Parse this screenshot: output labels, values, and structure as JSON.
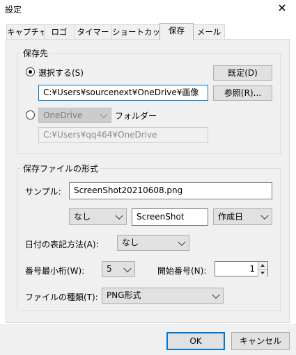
{
  "window": {
    "title": "設定",
    "close_glyph": "✕"
  },
  "tabs": [
    {
      "label": "キャプチャ",
      "active": false
    },
    {
      "label": "ロゴ",
      "active": false
    },
    {
      "label": "タイマー",
      "active": false
    },
    {
      "label": "ショートカット",
      "active": false
    },
    {
      "label": "保存",
      "active": true
    },
    {
      "label": "メール",
      "active": false
    }
  ],
  "save_dest": {
    "legend": "保存先",
    "select_radio_label": "選択する(S)",
    "select_checked": true,
    "default_button": "既定(D)",
    "path_value": "C:¥Users¥sourcenext¥OneDrive¥画像",
    "browse_button": "参照(R)...",
    "onedrive_radio_checked": false,
    "onedrive_select_value": "OneDrive",
    "folder_label": "フォルダー",
    "onedrive_path_value": "C:¥Users¥qq464¥OneDrive"
  },
  "format": {
    "legend": "保存ファイルの形式",
    "sample_label": "サンプル:",
    "sample_value": "ScreenShot20210608.png",
    "prefix_select": "なし",
    "name_value": "ScreenShot",
    "date_select": "作成日",
    "date_format_label": "日付の表記方法(A):",
    "date_format_value": "なし",
    "min_digits_label": "番号最小桁(W):",
    "min_digits_value": "5",
    "start_number_label": "開始番号(N):",
    "start_number_value": "1",
    "file_type_label": "ファイルの種類(T):",
    "file_type_value": "PNG形式"
  },
  "footer": {
    "ok_label": "OK",
    "cancel_label": "キャンセル"
  },
  "colors": {
    "focus": "#0078d7",
    "panel": "#f0f0f0"
  }
}
